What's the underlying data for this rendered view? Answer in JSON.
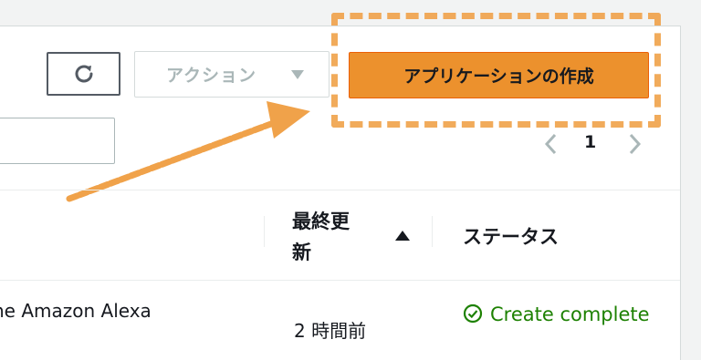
{
  "toolbar": {
    "refresh_icon": "refresh-icon",
    "actions_label": "アクション",
    "actions_caret_icon": "caret-down-icon",
    "create_label": "アプリケーションの作成"
  },
  "search": {
    "value": "",
    "placeholder": ""
  },
  "pagination": {
    "current_page": "1"
  },
  "table": {
    "columns": {
      "updated": "最終更新",
      "status": "ステータス"
    },
    "sort_icon": "sort-ascending-icon",
    "rows": [
      {
        "name": "he Amazon Alexa",
        "updated": "2 時間前",
        "status": "Create complete"
      }
    ]
  },
  "colors": {
    "primary": "#ec912d",
    "annotation": "#f0a24a",
    "success": "#1d8102"
  }
}
